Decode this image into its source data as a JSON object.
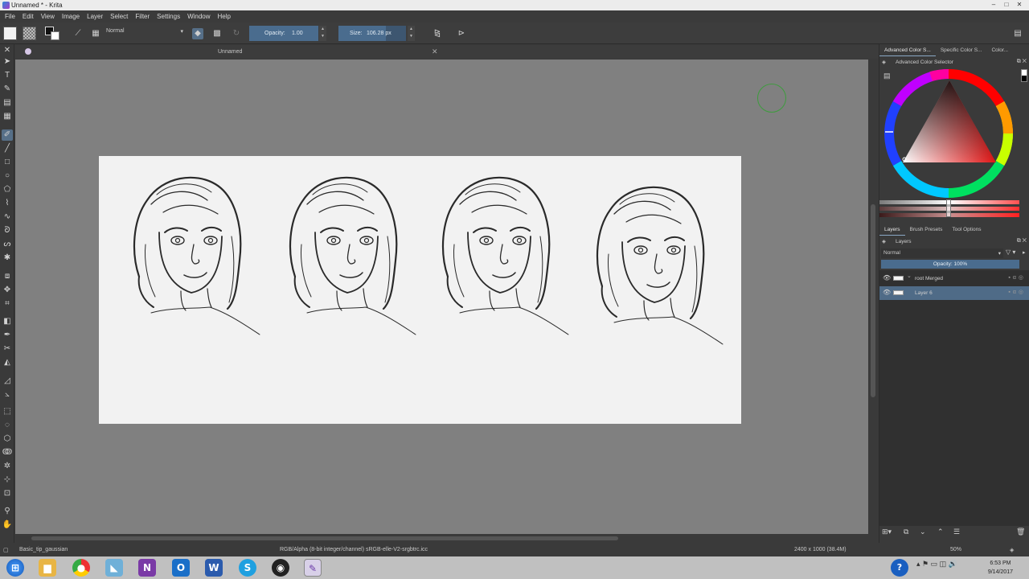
{
  "window": {
    "title": "Unnamed * - Krita",
    "controls": [
      "–",
      "□",
      "✕"
    ]
  },
  "menu": [
    "File",
    "Edit",
    "View",
    "Image",
    "Layer",
    "Select",
    "Filter",
    "Settings",
    "Window",
    "Help"
  ],
  "toolbar": {
    "blend_mode": "Normal",
    "opacity_label": "Opacity:",
    "opacity_value": "1.00",
    "size_label": "Size:",
    "size_value": "106.28 px"
  },
  "document": {
    "tab_title": "Unnamed"
  },
  "dockers": {
    "color_tabs": [
      "Advanced Color S...",
      "Specific Color S...",
      "Color..."
    ],
    "color_panel_title": "Advanced Color Selector",
    "layer_tabs": [
      "Layers",
      "Brush Presets",
      "Tool Options"
    ],
    "layers_panel_title": "Layers",
    "layer_blend": "Normal",
    "layer_opacity": "Opacity:  100%",
    "layers": [
      {
        "name": "root Merged",
        "selected": false
      },
      {
        "name": "Layer 6",
        "selected": true
      }
    ]
  },
  "status": {
    "brush": "Basic_tip_gaussian",
    "color_profile": "RGB/Alpha (8-bit integer/channel)  sRGB-elle-V2-srgbtrc.icc",
    "image_size": "2400 x 1000 (38.4M)",
    "zoom": "50%"
  },
  "taskbar": {
    "time": "6:53 PM",
    "date": "9/14/2017"
  },
  "colors": {
    "accent": "#4a6c8e",
    "canvas_bg": "#808080",
    "paper": "#f2f2f2",
    "cursor_ring": "#3d9c3d"
  }
}
